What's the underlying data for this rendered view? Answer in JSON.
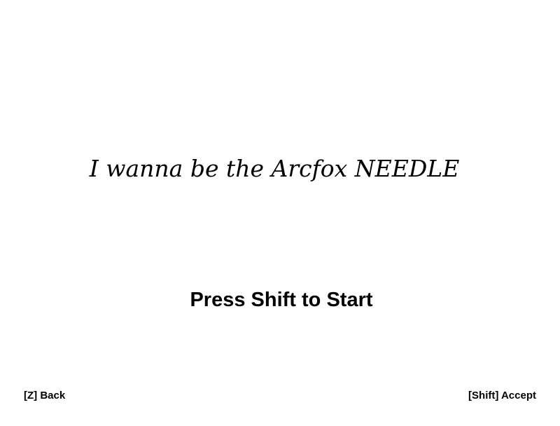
{
  "screen": {
    "game_title": "I wanna be the Arcfox NEEDLE",
    "start_prompt": "Press Shift to Start"
  },
  "controls": {
    "back_hint": "[Z] Back",
    "accept_hint": "[Shift] Accept"
  },
  "colors": {
    "background": "#ffffff",
    "text": "#000000"
  }
}
